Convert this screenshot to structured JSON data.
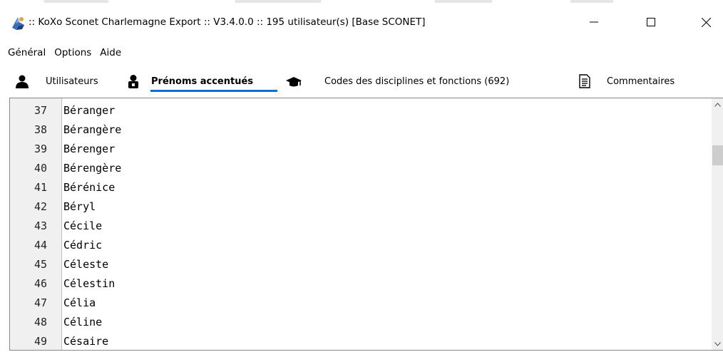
{
  "window": {
    "title": ":: KoXo Sconet Charlemagne Export :: V3.4.0.0 :: 195 utilisateur(s) [Base SCONET]",
    "app_icon": "koxo-app-icon",
    "minimize_icon": "minimize-icon",
    "maximize_icon": "maximize-icon",
    "close_icon": "close-icon"
  },
  "menu": [
    "Général",
    "Options",
    "Aide"
  ],
  "tabs": [
    {
      "label": "Utilisateurs",
      "icon": "user-icon"
    },
    {
      "label": "Prénoms accentués",
      "icon": "user-lock-icon",
      "active": true
    },
    {
      "label": "Codes des disciplines et fonctions (692)",
      "icon": "graduation-cap-icon"
    },
    {
      "label": "Commentaires",
      "icon": "document-icon"
    }
  ],
  "colors": {
    "accent": "#0a6fd6",
    "gutter": "#f0f0f0",
    "border": "#828790"
  },
  "list": {
    "scroll_position": 0.2,
    "rows": [
      {
        "num": "37",
        "name": "Béranger"
      },
      {
        "num": "38",
        "name": "Bérangère"
      },
      {
        "num": "39",
        "name": "Bérenger"
      },
      {
        "num": "40",
        "name": "Bérengère"
      },
      {
        "num": "41",
        "name": "Bérénice"
      },
      {
        "num": "42",
        "name": "Béryl"
      },
      {
        "num": "43",
        "name": "Cécile"
      },
      {
        "num": "44",
        "name": "Cédric"
      },
      {
        "num": "45",
        "name": "Céleste"
      },
      {
        "num": "46",
        "name": "Célestin"
      },
      {
        "num": "47",
        "name": "Célia"
      },
      {
        "num": "48",
        "name": "Céline"
      },
      {
        "num": "49",
        "name": "Césaire"
      }
    ]
  }
}
